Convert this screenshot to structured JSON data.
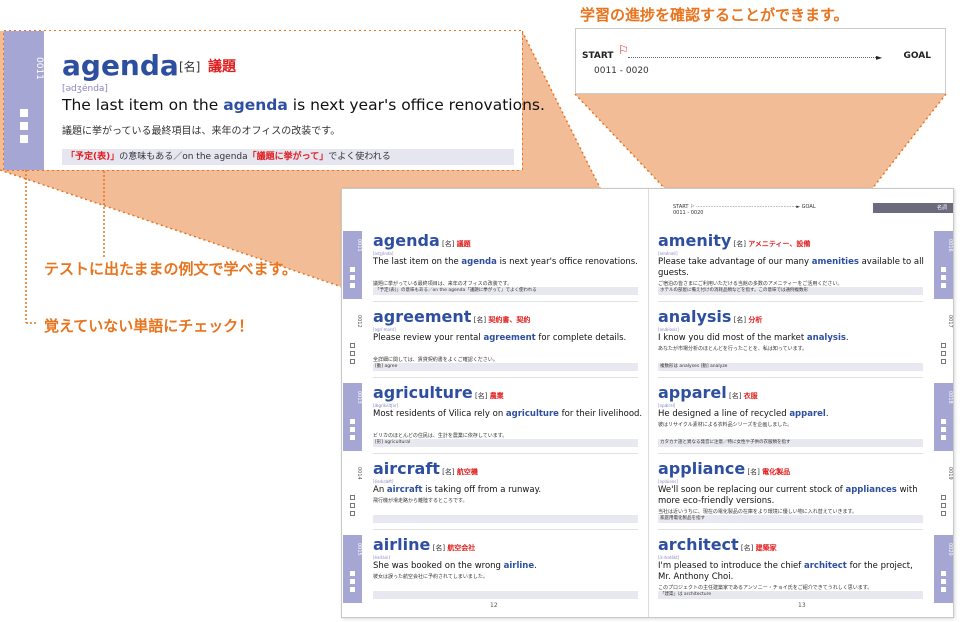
{
  "top_right_caption": "学習の進捗を確認することができます。",
  "left_callouts": {
    "test_example": "テストに出たままの例文で学べます。",
    "check_words": "覚えていない単語にチェック！"
  },
  "progress": {
    "start": "START",
    "goal": "GOAL",
    "range": "0011 - 0020"
  },
  "zoom_entry": {
    "number": "0011",
    "word": "agenda",
    "pos": "[名]",
    "meaning": "議題",
    "pron": "[ədʒénda]",
    "ex_before": "The last item on the ",
    "ex_word": "agenda",
    "ex_after": " is next year's office renovations.",
    "translation": "議題に挙がっている最終項目は、来年のオフィスの改装です。",
    "note_a": "「予定(表)」",
    "note_b": "の意味もある／on the agenda",
    "note_c": "「議題に挙がって」",
    "note_d": "でよく使われる"
  },
  "spread": {
    "name_label": "名詞",
    "page_left": "12",
    "page_right": "13",
    "mini_start": "START",
    "mini_goal": "GOAL",
    "mini_range": "0011 - 0020",
    "left_entries": [
      {
        "number": "0011",
        "word": "agenda",
        "pos": "[名]",
        "meaning": "議題",
        "pron": "[ədʒénda]",
        "ex_before": "The last item on the ",
        "ex_word": "agenda",
        "ex_after": " is next year's office renovations.",
        "translation": "議題に挙がっている最終項目は、来年のオフィスの改装です。",
        "note": "「予定(表)」の意味もある／on the agenda「議題に挙がって」でよく使われる"
      },
      {
        "number": "0012",
        "word": "agreement",
        "pos": "[名]",
        "meaning": "契約書、契約",
        "pron": "[əgrí:mənt]",
        "ex_before": "Please review your rental ",
        "ex_word": "agreement",
        "ex_after": " for complete details.",
        "translation": "全詳細に関しては、賃貸契約書をよくご確認ください。",
        "note": "[動] agree"
      },
      {
        "number": "0013",
        "word": "agriculture",
        "pos": "[名]",
        "meaning": "農業",
        "pron": "[ǽgrikʌ̀ltʃər]",
        "ex_before": "Most residents of Vilica rely on ",
        "ex_word": "agriculture",
        "ex_after": " for their livelihood.",
        "translation": "ビリカのほとんどの住民は、生計を農業に依存しています。",
        "note": "[形] agricultural"
      },
      {
        "number": "0014",
        "word": "aircraft",
        "pos": "[名]",
        "meaning": "航空機",
        "pron": "[éərkræ̀ft]",
        "ex_before": "An ",
        "ex_word": "aircraft",
        "ex_after": " is taking off from a runway.",
        "translation": "飛行機が滑走路から離陸するところです。",
        "note": ""
      },
      {
        "number": "0015",
        "word": "airline",
        "pos": "[名]",
        "meaning": "航空会社",
        "pron": "[éərlàin]",
        "ex_before": "She was booked on the wrong ",
        "ex_word": "airline",
        "ex_after": ".",
        "translation": "彼女は誤った航空会社に予約されてしまいました。",
        "note": ""
      }
    ],
    "right_entries": [
      {
        "number": "0016",
        "word": "amenity",
        "pos": "[名]",
        "meaning": "アメニティー、設備",
        "pron": "[əménəti]",
        "ex_before": "Please take advantage of our many ",
        "ex_word": "amenities",
        "ex_after": " available to all guests.",
        "translation": "ご宿泊の皆さまにご利用いただける当館の多数のアメニティーをご活用ください。",
        "note": "ホテルの部屋に備え付けの消耗品類などを指す。この意味では通例複数形"
      },
      {
        "number": "0017",
        "word": "analysis",
        "pos": "[名]",
        "meaning": "分析",
        "pron": "[ənǽləsis]",
        "ex_before": "I know you did most of the market ",
        "ex_word": "analysis",
        "ex_after": ".",
        "translation": "あなたが市場分析のほとんどを行ったことを、私は知っています。",
        "note": "複数形は analyses  [動] analyze"
      },
      {
        "number": "0018",
        "word": "apparel",
        "pos": "[名]",
        "meaning": "衣服",
        "pron": "[əpǽrəl]",
        "ex_before": "He designed a line of recycled ",
        "ex_word": "apparel",
        "ex_after": ".",
        "translation": "彼はリサイクル素材による衣料品シリーズを企画しました。",
        "note": "カタカナ語と異なる発音に注意／特に女性や子供の衣服類を指す"
      },
      {
        "number": "0019",
        "word": "appliance",
        "pos": "[名]",
        "meaning": "電化製品",
        "pron": "[əpláiəns]",
        "ex_before": "We'll soon be replacing our current stock of ",
        "ex_word": "appliances",
        "ex_after": " with more eco-friendly versions.",
        "translation": "当社は近いうちに、現在の電化製品の在庫をより環境に優しい物に入れ替えていきます。",
        "note": "家庭用電化製品を指す"
      },
      {
        "number": "0020",
        "word": "architect",
        "pos": "[名]",
        "meaning": "建築家",
        "pron": "[ɑ́:rkətèkt]",
        "ex_before": "I'm pleased to introduce the chief ",
        "ex_word": "architect",
        "ex_after": " for the project, Mr. Anthony Choi.",
        "translation": "このプロジェクトの主任建築家であるアンソニー・チョイ氏をご紹介できてうれしく思います。",
        "note": "「建築」は architecture"
      }
    ]
  }
}
